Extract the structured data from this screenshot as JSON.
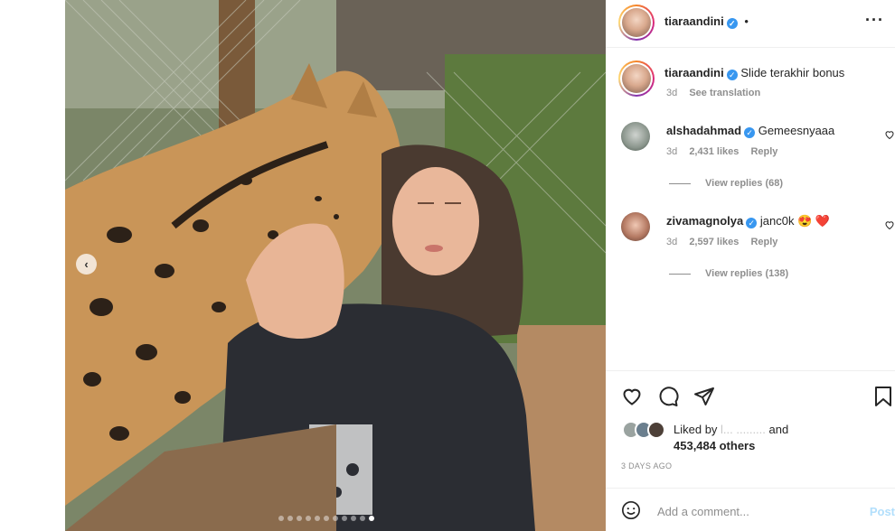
{
  "post": {
    "username": "tiaraandini",
    "header_dot": "•",
    "more_icon": "more-horizontal-icon"
  },
  "caption": {
    "username": "tiaraandini",
    "text": "Slide terakhir bonus",
    "time": "3d",
    "see_translation": "See translation"
  },
  "comments": [
    {
      "username": "alshadahmad",
      "text": "Gemeesnyaaa",
      "time": "3d",
      "likes": "2,431 likes",
      "reply": "Reply",
      "view_replies": "View replies (68)"
    },
    {
      "username": "zivamagnolya",
      "text": "janc0k 😍 ❤️",
      "time": "3d",
      "likes": "2,597 likes",
      "reply": "Reply",
      "view_replies": "View replies (138)"
    }
  ],
  "likes": {
    "prefix": "Liked by",
    "blurred_name": "l... .........",
    "and": "and",
    "count": "453,484 others"
  },
  "date": "3 DAYS AGO",
  "add_comment": {
    "placeholder": "Add a comment...",
    "post_label": "Post"
  },
  "media": {
    "carousel_total": 11,
    "carousel_active": 11,
    "prev_icon": "‹"
  },
  "colors": {
    "verified": "#3897f0",
    "post_disabled": "#b2dffc",
    "heart_emoji": "#e0245e"
  }
}
